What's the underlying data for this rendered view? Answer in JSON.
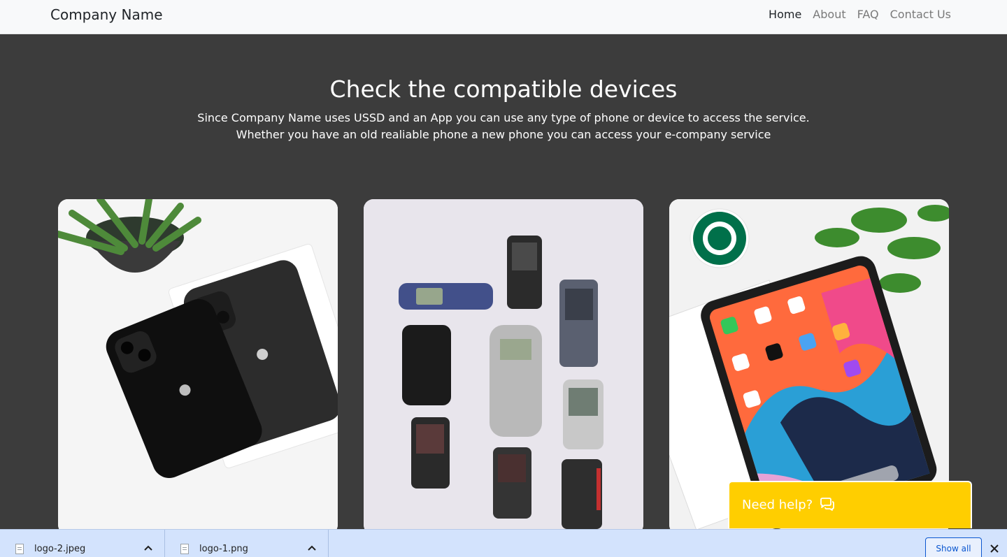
{
  "navbar": {
    "brand": "Company Name",
    "links": [
      {
        "label": "Home",
        "active": true
      },
      {
        "label": "About",
        "active": false
      },
      {
        "label": "FAQ",
        "active": false
      },
      {
        "label": "Contact Us",
        "active": false
      }
    ]
  },
  "hero": {
    "title": "Check the compatible devices",
    "line1": "Since Company Name uses USSD and an App you can use any type of phone or device to access the service.",
    "line2": "Whether you have an old realiable phone a new phone you can access your e-company service"
  },
  "cards": [
    {
      "image": "iphone-photo"
    },
    {
      "image": "old-phones-photo"
    },
    {
      "image": "ipad-photo"
    }
  ],
  "help": {
    "label": "Need help?",
    "icon": "chat-bubbles-icon",
    "color": "#ffce00"
  },
  "downloads": {
    "items": [
      {
        "name": "logo-2.jpeg"
      },
      {
        "name": "logo-1.png"
      }
    ],
    "show_all": "Show all"
  },
  "colors": {
    "navbar_bg": "#f8f9fa",
    "page_bg": "#3c3c3c",
    "download_bar_bg": "#d3e3fd",
    "accent": "#0b57d0"
  }
}
